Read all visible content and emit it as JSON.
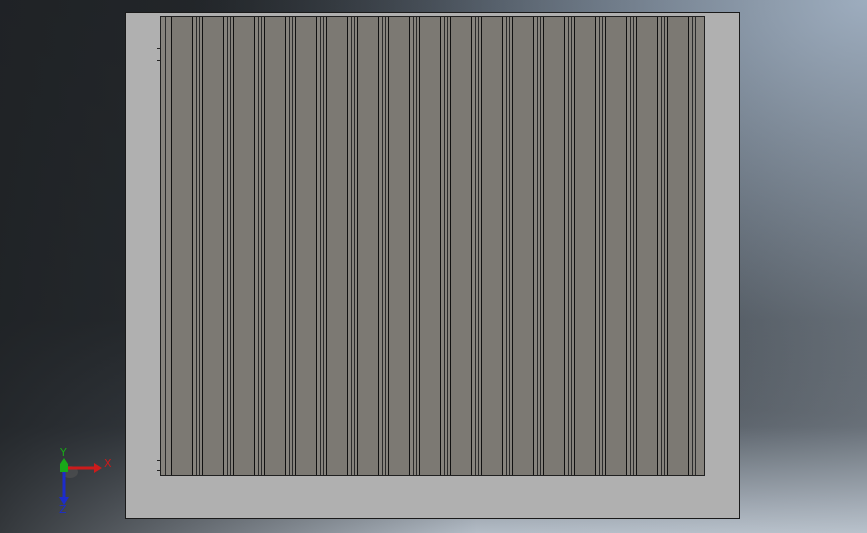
{
  "viewport": {
    "background_top": "#262a2e",
    "background_bottom": "#b3bcc6"
  },
  "model": {
    "plate_color": "#b0b0b0",
    "fin_color": "#86837d",
    "edge_color": "#111111"
  },
  "triad": {
    "x_label": "X",
    "y_label": "Y",
    "z_label": "Z",
    "x_color": "#cc1b1b",
    "y_color": "#18a818",
    "z_color": "#1c2ccc"
  }
}
